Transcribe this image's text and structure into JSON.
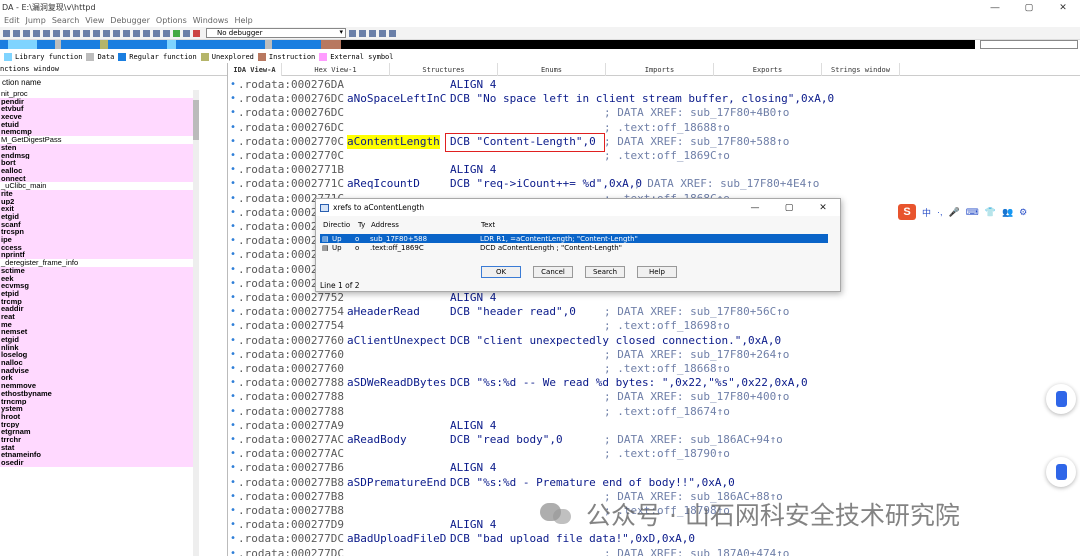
{
  "window": {
    "title": "DA - E:\\漏洞复现\\v\\httpd",
    "controls": [
      "—",
      "▢",
      "✕"
    ]
  },
  "menu": [
    "Edit",
    "Jump",
    "Search",
    "View",
    "Debugger",
    "Options",
    "Windows",
    "Help"
  ],
  "toolbar": {
    "debugger_select": "No debugger"
  },
  "legend": [
    {
      "label": "Library function",
      "color": "#7fd4ff"
    },
    {
      "label": "Data",
      "color": "#bdbdbd"
    },
    {
      "label": "Regular function",
      "color": "#1a7ee0"
    },
    {
      "label": "Unexplored",
      "color": "#b5b56a"
    },
    {
      "label": "Instruction",
      "color": "#b87860"
    },
    {
      "label": "External symbol",
      "color": "#ff9cff"
    }
  ],
  "functions_panel": {
    "title": "nctions window",
    "column_header": "ction name",
    "items": [
      {
        "name": "nit_proc",
        "style": "plain"
      },
      {
        "name": "pendir",
        "style": "lib"
      },
      {
        "name": "etvbuf",
        "style": "lib"
      },
      {
        "name": "xecve",
        "style": "lib"
      },
      {
        "name": "etuid",
        "style": "lib"
      },
      {
        "name": "nemcmp",
        "style": "lib"
      },
      {
        "name": "M_GetDigestPass",
        "style": "plain"
      },
      {
        "name": "sten",
        "style": "lib"
      },
      {
        "name": "endmsg",
        "style": "lib"
      },
      {
        "name": "bort",
        "style": "lib"
      },
      {
        "name": "ealloc",
        "style": "lib"
      },
      {
        "name": "onnect",
        "style": "lib"
      },
      {
        "name": "_uClibc_main",
        "style": "plain"
      },
      {
        "name": "rite",
        "style": "lib"
      },
      {
        "name": "up2",
        "style": "lib"
      },
      {
        "name": "exit",
        "style": "lib"
      },
      {
        "name": "etgid",
        "style": "lib"
      },
      {
        "name": "scanf",
        "style": "lib"
      },
      {
        "name": "trcspn",
        "style": "lib"
      },
      {
        "name": "ipe",
        "style": "lib"
      },
      {
        "name": "ccess",
        "style": "lib"
      },
      {
        "name": "nprintf",
        "style": "lib"
      },
      {
        "name": "_deregister_frame_info",
        "style": "plain"
      },
      {
        "name": "sctime",
        "style": "lib"
      },
      {
        "name": "eek",
        "style": "lib"
      },
      {
        "name": "ecvmsg",
        "style": "lib"
      },
      {
        "name": "etpid",
        "style": "lib"
      },
      {
        "name": "trcmp",
        "style": "lib"
      },
      {
        "name": "eaddir",
        "style": "lib"
      },
      {
        "name": "reat",
        "style": "lib"
      },
      {
        "name": "me",
        "style": "lib"
      },
      {
        "name": "nemset",
        "style": "lib"
      },
      {
        "name": "etgid",
        "style": "lib"
      },
      {
        "name": "nlink",
        "style": "lib"
      },
      {
        "name": "loselog",
        "style": "lib"
      },
      {
        "name": "nalloc",
        "style": "lib"
      },
      {
        "name": "nadvise",
        "style": "lib"
      },
      {
        "name": "ork",
        "style": "lib"
      },
      {
        "name": "nemmove",
        "style": "lib"
      },
      {
        "name": "ethostbyname",
        "style": "lib"
      },
      {
        "name": "trncmp",
        "style": "lib"
      },
      {
        "name": "ystem",
        "style": "lib"
      },
      {
        "name": "hroot",
        "style": "lib"
      },
      {
        "name": "trcpy",
        "style": "lib"
      },
      {
        "name": "etgrnam",
        "style": "lib"
      },
      {
        "name": "trrchr",
        "style": "lib"
      },
      {
        "name": "stat",
        "style": "lib"
      },
      {
        "name": "etnameinfo",
        "style": "lib"
      },
      {
        "name": "osedir",
        "style": "lib"
      }
    ]
  },
  "tabs": [
    {
      "label": "IDA View-A",
      "active": true
    },
    {
      "label": "Hex View-1",
      "active": false
    },
    {
      "label": "Structures",
      "active": false
    },
    {
      "label": "Enums",
      "active": false
    },
    {
      "label": "Imports",
      "active": false
    },
    {
      "label": "Exports",
      "active": false
    },
    {
      "label": "Strings window",
      "active": false
    }
  ],
  "listing": [
    {
      "addr": ".rodata:000276DA",
      "label": "",
      "op": "ALIGN 4",
      "cmt": ""
    },
    {
      "addr": ".rodata:000276DC",
      "label": "aNoSpaceLeftInC",
      "op": "DCB \"No space left in client stream buffer, closing\",0xA,0",
      "cmt": ""
    },
    {
      "addr": ".rodata:000276DC",
      "label": "",
      "op": "",
      "cmt": "; DATA XREF: sub_17F80+4B0↑o"
    },
    {
      "addr": ".rodata:000276DC",
      "label": "",
      "op": "",
      "cmt": "; .text:off_18688↑o"
    },
    {
      "addr": ".rodata:0002770C",
      "label": "aContentLength",
      "op": "DCB \"Content-Length\",0",
      "cmt": "; DATA XREF: sub_17F80+588↑o",
      "highlight": true
    },
    {
      "addr": ".rodata:0002770C",
      "label": "",
      "op": "",
      "cmt": "; .text:off_1869C↑o"
    },
    {
      "addr": ".rodata:0002771B",
      "label": "",
      "op": "ALIGN 4",
      "cmt": ""
    },
    {
      "addr": ".rodata:0002771C",
      "label": "aReqIcountD",
      "op": "DCB \"req->iCount++= %d\",0xA,0",
      "cmt": "",
      "inline_cmt": "; DATA XREF: sub_17F80+4E4↑o"
    },
    {
      "addr": ".rodata:0002771C",
      "label": "",
      "op": "",
      "cmt": "; .text:off_1868C↑o"
    },
    {
      "addr": ".rodata:0002",
      "label": "",
      "op": "",
      "cmt": ""
    },
    {
      "addr": ".rodata:0002",
      "label": "",
      "op": "",
      "cmt": ""
    },
    {
      "addr": ".rodata:0002",
      "label": "",
      "op": "",
      "cmt": ""
    },
    {
      "addr": ".rodata:0002",
      "label": "",
      "op": "",
      "cmt": ""
    },
    {
      "addr": ".rodata:0002",
      "label": "",
      "op": "",
      "cmt": ""
    },
    {
      "addr": ".rodata:0002",
      "label": "",
      "op": "",
      "cmt": ""
    },
    {
      "addr": ".rodata:00027752",
      "label": "",
      "op": "ALIGN 4",
      "cmt": ""
    },
    {
      "addr": ".rodata:00027754",
      "label": "aHeaderRead",
      "op": "DCB \"header read\",0",
      "cmt": "; DATA XREF: sub_17F80+56C↑o"
    },
    {
      "addr": ".rodata:00027754",
      "label": "",
      "op": "",
      "cmt": "; .text:off_18698↑o"
    },
    {
      "addr": ".rodata:00027760",
      "label": "aClientUnexpect",
      "op": "DCB \"client unexpectedly closed connection.\",0xA,0",
      "cmt": ""
    },
    {
      "addr": ".rodata:00027760",
      "label": "",
      "op": "",
      "cmt": "; DATA XREF: sub_17F80+264↑o"
    },
    {
      "addr": ".rodata:00027760",
      "label": "",
      "op": "",
      "cmt": "; .text:off_18668↑o"
    },
    {
      "addr": ".rodata:00027788",
      "label": "aSDWeReadDBytes",
      "op": "DCB \"%s:%d -- We read %d bytes: \",0x22,\"%s\",0x22,0xA,0",
      "cmt": ""
    },
    {
      "addr": ".rodata:00027788",
      "label": "",
      "op": "",
      "cmt": "; DATA XREF: sub_17F80+400↑o"
    },
    {
      "addr": ".rodata:00027788",
      "label": "",
      "op": "",
      "cmt": "; .text:off_18674↑o"
    },
    {
      "addr": ".rodata:000277A9",
      "label": "",
      "op": "ALIGN 4",
      "cmt": ""
    },
    {
      "addr": ".rodata:000277AC",
      "label": "aReadBody",
      "op": "DCB \"read body\",0",
      "cmt": "; DATA XREF: sub_186AC+94↑o"
    },
    {
      "addr": ".rodata:000277AC",
      "label": "",
      "op": "",
      "cmt": "; .text:off_18790↑o"
    },
    {
      "addr": ".rodata:000277B6",
      "label": "",
      "op": "ALIGN 4",
      "cmt": ""
    },
    {
      "addr": ".rodata:000277B8",
      "label": "aSDPrematureEnd",
      "op": "DCB \"%s:%d - Premature end of body!!\",0xA,0",
      "cmt": ""
    },
    {
      "addr": ".rodata:000277B8",
      "label": "",
      "op": "",
      "cmt": "; DATA XREF: sub_186AC+88↑o"
    },
    {
      "addr": ".rodata:000277B8",
      "label": "",
      "op": "",
      "cmt": "; .text:off_18798↑o"
    },
    {
      "addr": ".rodata:000277D9",
      "label": "",
      "op": "ALIGN 4",
      "cmt": ""
    },
    {
      "addr": ".rodata:000277DC",
      "label": "aBadUploadFileD",
      "op": "DCB \"bad upload file data!\",0xD,0xA,0",
      "cmt": ""
    },
    {
      "addr": ".rodata:000277DC",
      "label": "",
      "op": "",
      "cmt": "; DATA XREF: sub_187A0+474↑o"
    }
  ],
  "xrefs_dialog": {
    "title": "xrefs to aContentLength",
    "columns": [
      "Directio",
      "Ty",
      "Address",
      "Text"
    ],
    "rows": [
      {
        "direction": "Up",
        "type": "o",
        "address": "sub_17F80+588",
        "text": "LDR     R1, =aContentLength; \"Content-Length\"",
        "selected": true
      },
      {
        "direction": "Up",
        "type": "o",
        "address": ".text:off_1869C",
        "text": "DCD aContentLength     ; \"Content-Length\"",
        "selected": false
      }
    ],
    "buttons": [
      "OK",
      "Cancel",
      "Search",
      "Help"
    ],
    "status": "Line 1 of 2",
    "controls": [
      "—",
      "▢",
      "✕"
    ]
  },
  "ime_toolbar": {
    "logo": "S",
    "items": [
      "中",
      "·,",
      "🎤",
      "⌨",
      "👕",
      "👥",
      "⚙"
    ]
  },
  "watermark": "公众号 · 山石网科安全技术研究院",
  "colors": {
    "highlight": "#ffff00",
    "selection": "#0a64c8",
    "annotation_red": "#e02020",
    "lib_function_bg": "#ffd9ff"
  }
}
